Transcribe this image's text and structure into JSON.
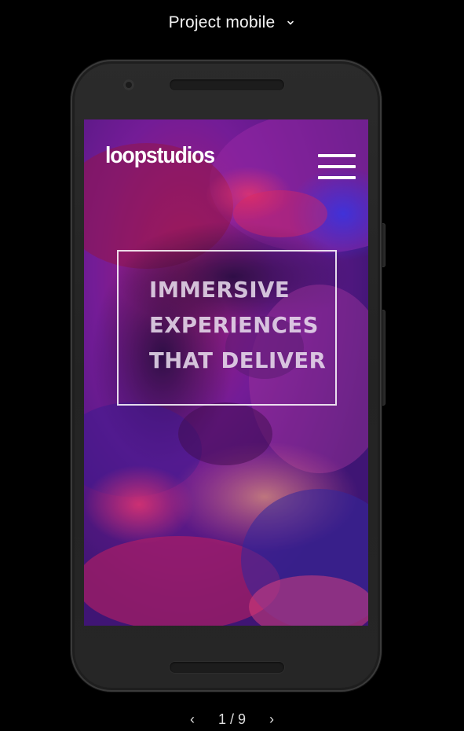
{
  "header": {
    "title": "Project mobile",
    "dropdown_icon": "chevron-down-icon"
  },
  "site": {
    "logo": "loopstudios",
    "menu_icon": "hamburger-menu-icon",
    "hero_lines": [
      "IMMERSIVE",
      "EXPERIENCES",
      "THAT DELIVER"
    ]
  },
  "pager": {
    "prev_icon": "chevron-left-icon",
    "label": "1 / 9",
    "next_icon": "chevron-right-icon"
  },
  "colors": {
    "page_bg": "#000000",
    "device_body": "#262626",
    "screen_tint": "#7a1fa0",
    "hero_text": "#e6dcef"
  }
}
